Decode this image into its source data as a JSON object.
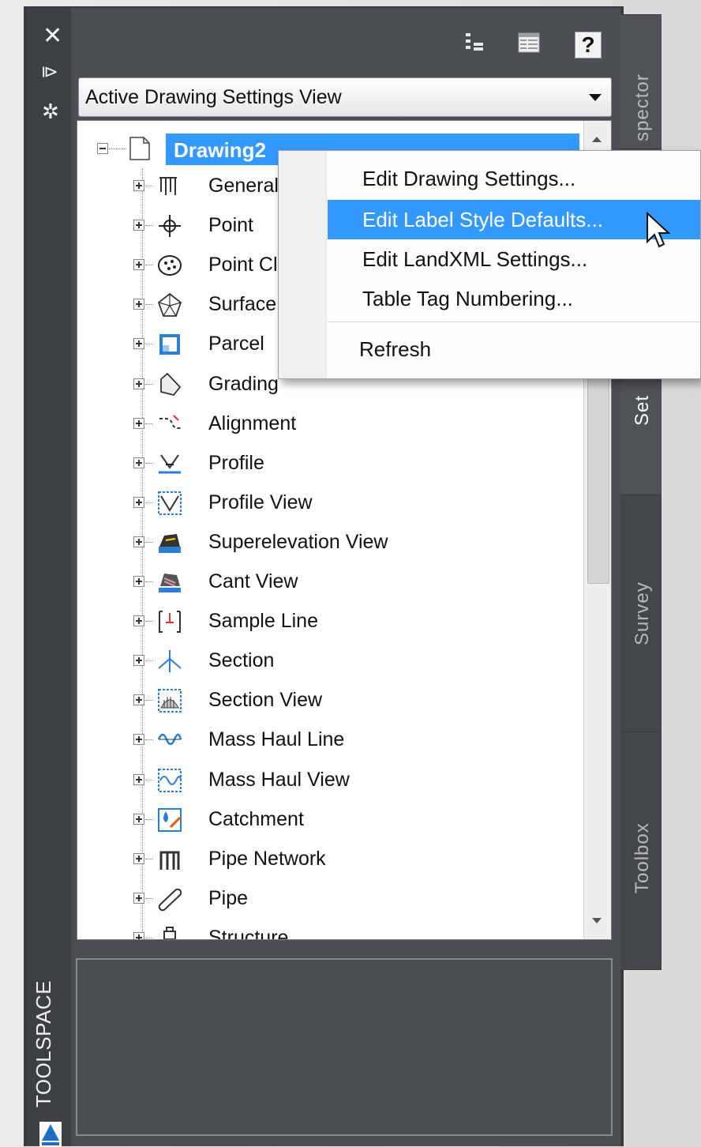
{
  "palette": {
    "side_strip": "#3c3f44",
    "panel": "#4b4e53",
    "selection": "#3399ff",
    "menu_bg": "#fdfdfd"
  },
  "sidebar": {
    "close_icon": "close-icon",
    "pin_icon": "autohide-icon",
    "gear_icon": "properties-icon",
    "title": "TOOLSPACE"
  },
  "toolbar": {
    "icons": [
      "tree-view-icon",
      "item-view-icon"
    ],
    "help_label": "?"
  },
  "view_selector": {
    "value": "Active Drawing Settings View"
  },
  "tree": {
    "root_label": "Drawing2",
    "items": [
      {
        "label": "General",
        "icon": "general-icon"
      },
      {
        "label": "Point",
        "icon": "point-icon"
      },
      {
        "label": "Point Cloud",
        "icon": "point-cloud-icon"
      },
      {
        "label": "Surface",
        "icon": "surface-icon"
      },
      {
        "label": "Parcel",
        "icon": "parcel-icon"
      },
      {
        "label": "Grading",
        "icon": "grading-icon"
      },
      {
        "label": "Alignment",
        "icon": "alignment-icon"
      },
      {
        "label": "Profile",
        "icon": "profile-icon"
      },
      {
        "label": "Profile View",
        "icon": "profile-view-icon"
      },
      {
        "label": "Superelevation View",
        "icon": "superelevation-view-icon"
      },
      {
        "label": "Cant View",
        "icon": "cant-view-icon"
      },
      {
        "label": "Sample Line",
        "icon": "sample-line-icon"
      },
      {
        "label": "Section",
        "icon": "section-icon"
      },
      {
        "label": "Section View",
        "icon": "section-view-icon"
      },
      {
        "label": "Mass Haul Line",
        "icon": "mass-haul-line-icon"
      },
      {
        "label": "Mass Haul View",
        "icon": "mass-haul-view-icon"
      },
      {
        "label": "Catchment",
        "icon": "catchment-icon"
      },
      {
        "label": "Pipe Network",
        "icon": "pipe-network-icon"
      },
      {
        "label": "Pipe",
        "icon": "pipe-icon"
      },
      {
        "label": "Structure",
        "icon": "structure-icon"
      }
    ]
  },
  "tabs": [
    {
      "label": "Prospector",
      "active": false
    },
    {
      "label": "Settings",
      "active": true
    },
    {
      "label": "Survey",
      "active": false
    },
    {
      "label": "Toolbox",
      "active": false
    }
  ],
  "tab_visible_text": [
    "spector",
    "Set",
    "Survey",
    "Toolbox"
  ],
  "context_menu": {
    "items": [
      {
        "label": "Edit Drawing Settings...",
        "highlighted": false
      },
      {
        "label": "Edit Label Style Defaults...",
        "highlighted": true
      },
      {
        "label": "Edit LandXML Settings...",
        "highlighted": false
      },
      {
        "label": "Table Tag Numbering...",
        "highlighted": false
      },
      {
        "label": "Refresh",
        "highlighted": false
      }
    ]
  }
}
